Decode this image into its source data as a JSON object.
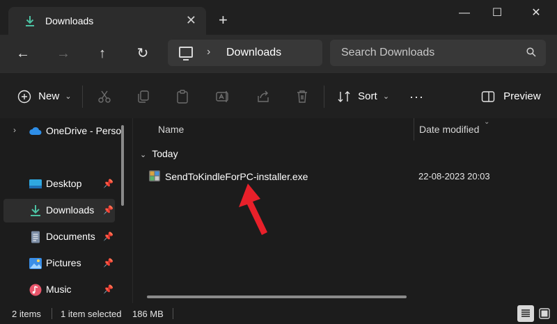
{
  "window": {
    "tab_title": "Downloads",
    "tab_icon": "download-icon",
    "close_tab_glyph": "✕",
    "new_tab_glyph": "+",
    "minimize_glyph": "—",
    "maximize_glyph": "☐",
    "close_glyph": "✕"
  },
  "navigation": {
    "back_glyph": "←",
    "forward_glyph": "→",
    "up_glyph": "↑",
    "refresh_glyph": "↻",
    "breadcrumb_separator": "›",
    "breadcrumb": "Downloads",
    "search_placeholder": "Search Downloads"
  },
  "toolbar": {
    "new_label": "New",
    "sort_label": "Sort",
    "more_glyph": "···",
    "preview_label": "Preview"
  },
  "sidebar": {
    "expander_glyph": "›",
    "pin_glyph": "📌",
    "items": [
      {
        "label": "OneDrive - Perso",
        "icon": "cloud-icon",
        "pinned": false
      },
      {
        "label": "Desktop",
        "icon": "desktop-icon",
        "pinned": true
      },
      {
        "label": "Downloads",
        "icon": "download-icon",
        "pinned": true,
        "selected": true
      },
      {
        "label": "Documents",
        "icon": "document-icon",
        "pinned": true
      },
      {
        "label": "Pictures",
        "icon": "picture-icon",
        "pinned": true
      },
      {
        "label": "Music",
        "icon": "music-icon",
        "pinned": true
      }
    ]
  },
  "content": {
    "columns": [
      "Name",
      "Date modified"
    ],
    "group_chevron": "⌄",
    "group": "Today",
    "files": [
      {
        "name": "SendToKindleForPC-installer.exe",
        "date_modified": "22-08-2023 20:03"
      }
    ]
  },
  "status": {
    "items_count": "2 items",
    "selected": "1 item selected",
    "size": "186 MB"
  },
  "colors": {
    "background": "#1c1c1c",
    "accent_green": "#4cc2a3",
    "annotation_red": "#e8202a"
  }
}
